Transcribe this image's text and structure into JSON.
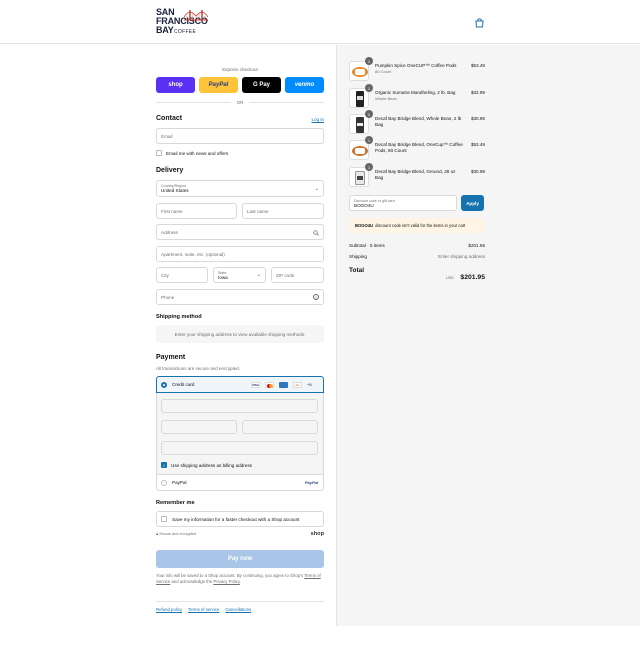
{
  "brand": {
    "line1": "SAN",
    "line2": "FRANCISCO",
    "line3": "BAY",
    "line4": "COFFEE"
  },
  "express": {
    "label": "Express checkout",
    "or": "OR",
    "shop": "shop",
    "paypal": "PayPal",
    "gpay": "G Pay",
    "venmo": "venmo"
  },
  "contact": {
    "title": "Contact",
    "login": "Log in",
    "email_placeholder": "Email",
    "news": "Email me with news and offers"
  },
  "delivery": {
    "title": "Delivery",
    "country_label": "Country/Region",
    "country_value": "United States",
    "first": "First name",
    "last": "Last name",
    "address": "Address",
    "apt": "Apartment, suite, etc. (optional)",
    "city": "City",
    "state_label": "State",
    "state_value": "Iowa",
    "zip": "ZIP code",
    "phone": "Phone"
  },
  "shipping": {
    "title": "Shipping method",
    "message": "Enter your shipping address to view available shipping methods."
  },
  "payment": {
    "title": "Payment",
    "sub": "All transactions are secure and encrypted.",
    "credit": "Credit card",
    "more": "+5",
    "billing": "Use shipping address as billing address",
    "paypal": "PayPal",
    "paypal_logo": "PayPal"
  },
  "remember": {
    "title": "Remember me",
    "save": "Save my information for a faster checkout with a Shop account",
    "secure": "Secure and encrypted",
    "shop": "shop"
  },
  "pay": {
    "label": "Pay now"
  },
  "legal": {
    "text1": "Your info will be saved to a Shop account. By continuing, you agree to Shop's",
    "terms": "Terms of Service",
    "and": "and acknowledge the",
    "privacy": "Privacy Policy",
    "end": "."
  },
  "footer": {
    "refund": "Refund policy",
    "terms": "Terms of service",
    "cancel": "Cancellations"
  },
  "items": [
    {
      "name": "Pumpkin Spice OneCUP™ Coffee Pods",
      "sub": "80 Count",
      "price": "$53.49",
      "qty": "1"
    },
    {
      "name": "Organic Sumatra Mandheling, 2 lb. Bag",
      "sub": "Whole Bean",
      "price": "$32.99",
      "qty": "1"
    },
    {
      "name": "Decaf Bay Bridge Blend, Whole Bean, 2 lb Bag",
      "sub": "",
      "price": "$30.99",
      "qty": "1"
    },
    {
      "name": "Decaf Bay Bridge Blend, OneCup™ Coffee Pods, 80 Count",
      "sub": "",
      "price": "$53.49",
      "qty": "1"
    },
    {
      "name": "Decaf Bay Bridge Blend, Ground, 28 oz Bag",
      "sub": "",
      "price": "$30.99",
      "qty": "1"
    }
  ],
  "discount": {
    "label": "Discount code or gift card",
    "value": "BOGO4U",
    "apply": "Apply",
    "error_code": "BOGO4U",
    "error_text": "discount code isn't valid for the items in your cart"
  },
  "totals": {
    "subtotal_label": "Subtotal · 5 items",
    "subtotal": "$201.95",
    "shipping_label": "Shipping",
    "shipping": "Enter shipping address",
    "total_label": "Total",
    "currency": "USD",
    "total": "$201.95"
  },
  "colors": {
    "accent": "#1773b0",
    "shop": "#5a31f4",
    "paypal": "#ffc439",
    "venmo": "#008cff",
    "pay_disabled": "#a9c6e8"
  }
}
